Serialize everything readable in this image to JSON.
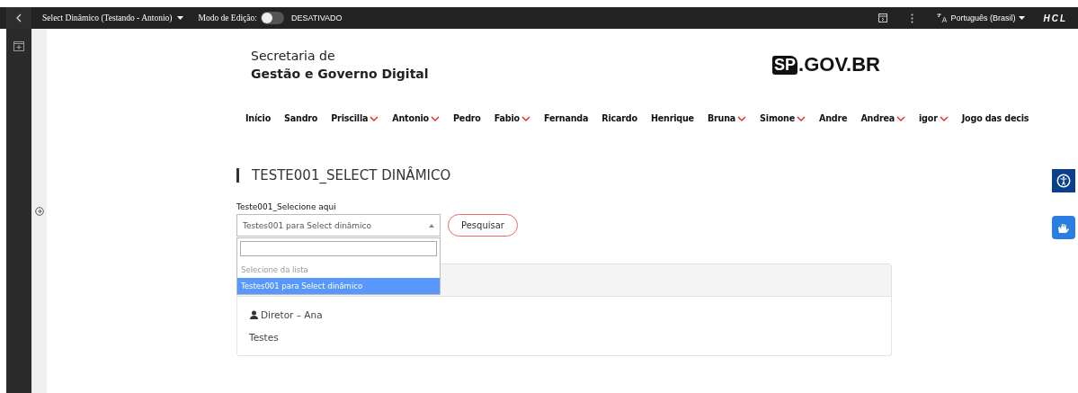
{
  "topbar": {
    "page_title": "Select Dinâmico (Testando - Antonio)",
    "edit_mode_label": "Modo de Edição:",
    "edit_mode": {
      "on": false,
      "status": "DESATIVADO"
    },
    "language": "Português (Brasil)",
    "brand": "HCL"
  },
  "header": {
    "org_line1": "Secretaria de",
    "org_line2": "Gestão e Governo Digital",
    "logo_mark": "SP",
    "logo_text": ".GOV.BR"
  },
  "nav": [
    {
      "label": "Início",
      "has_menu": false
    },
    {
      "label": "Sandro",
      "has_menu": false
    },
    {
      "label": "Priscilla",
      "has_menu": true
    },
    {
      "label": "Antonio",
      "has_menu": true
    },
    {
      "label": "Pedro",
      "has_menu": false
    },
    {
      "label": "Fabio",
      "has_menu": true
    },
    {
      "label": "Fernanda",
      "has_menu": false
    },
    {
      "label": "Ricardo",
      "has_menu": false
    },
    {
      "label": "Henrique",
      "has_menu": false
    },
    {
      "label": "Bruna",
      "has_menu": true
    },
    {
      "label": "Simone",
      "has_menu": true
    },
    {
      "label": "Andre",
      "has_menu": false
    },
    {
      "label": "Andrea",
      "has_menu": true
    },
    {
      "label": "igor",
      "has_menu": true
    },
    {
      "label": "Jogo das decis",
      "has_menu": false
    }
  ],
  "page_heading": "TESTE001_SELECT DINÂMICO",
  "form": {
    "label": "Teste001_Selecione aqui",
    "select_value": "Testes001 para Select dinâmico",
    "expanded": true,
    "options": [
      {
        "label": "Selecione da lista",
        "kind": "placeholder",
        "selected": false
      },
      {
        "label": "Testes001 para Select dinâmico",
        "kind": "option",
        "selected": true
      }
    ],
    "button": "Pesquisar"
  },
  "card": {
    "person": "Diretor – Ana",
    "text": "Testes"
  }
}
